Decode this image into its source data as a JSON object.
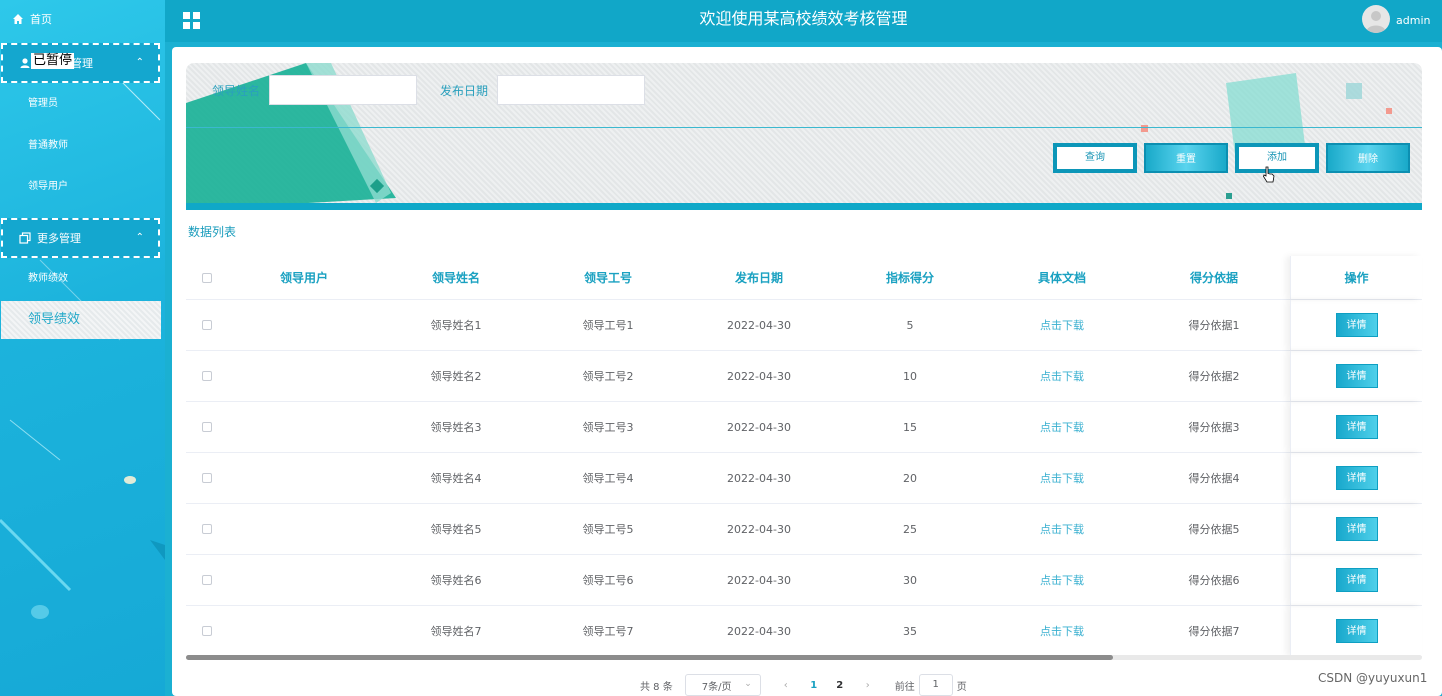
{
  "sidebar": {
    "home": "首页",
    "group1": "管理",
    "group1_items": [
      "管理员",
      "普通教师",
      "领导用户"
    ],
    "group2": "更多管理",
    "group2_items": [
      "教师绩效",
      "领导绩效"
    ],
    "overlay_text": "已暂停"
  },
  "header": {
    "title": "欢迎使用某高校绩效考核管理",
    "user": "admin"
  },
  "search": {
    "name_label": "领导姓名",
    "date_label": "发布日期",
    "name_value": "",
    "date_value": "",
    "buttons": {
      "query": "查询",
      "reset": "重置",
      "add": "添加",
      "delete": "删除"
    }
  },
  "list_title": "数据列表",
  "table": {
    "headers": [
      "领导用户",
      "领导姓名",
      "领导工号",
      "发布日期",
      "指标得分",
      "具体文档",
      "得分依据",
      "操作"
    ],
    "rows": [
      {
        "user": "",
        "name": "领导姓名1",
        "id": "领导工号1",
        "date": "2022-04-30",
        "score": "5",
        "doc": "点击下载",
        "basis": "得分依据1",
        "action": "详情"
      },
      {
        "user": "",
        "name": "领导姓名2",
        "id": "领导工号2",
        "date": "2022-04-30",
        "score": "10",
        "doc": "点击下载",
        "basis": "得分依据2",
        "action": "详情"
      },
      {
        "user": "",
        "name": "领导姓名3",
        "id": "领导工号3",
        "date": "2022-04-30",
        "score": "15",
        "doc": "点击下载",
        "basis": "得分依据3",
        "action": "详情"
      },
      {
        "user": "",
        "name": "领导姓名4",
        "id": "领导工号4",
        "date": "2022-04-30",
        "score": "20",
        "doc": "点击下载",
        "basis": "得分依据4",
        "action": "详情"
      },
      {
        "user": "",
        "name": "领导姓名5",
        "id": "领导工号5",
        "date": "2022-04-30",
        "score": "25",
        "doc": "点击下载",
        "basis": "得分依据5",
        "action": "详情"
      },
      {
        "user": "",
        "name": "领导姓名6",
        "id": "领导工号6",
        "date": "2022-04-30",
        "score": "30",
        "doc": "点击下载",
        "basis": "得分依据6",
        "action": "详情"
      },
      {
        "user": "",
        "name": "领导姓名7",
        "id": "领导工号7",
        "date": "2022-04-30",
        "score": "35",
        "doc": "点击下载",
        "basis": "得分依据7",
        "action": "详情"
      }
    ]
  },
  "pagination": {
    "total": "共 8 条",
    "page_size": "7条/页",
    "pages": [
      "1",
      "2"
    ],
    "current": "1",
    "goto_prefix": "前往",
    "goto_value": "1",
    "goto_suffix": "页"
  },
  "watermark": "CSDN @yuyuxun1",
  "colors": {
    "accent": "#11a7c8",
    "sidebar": "#1cb3dc",
    "link": "#3ab0d0"
  }
}
